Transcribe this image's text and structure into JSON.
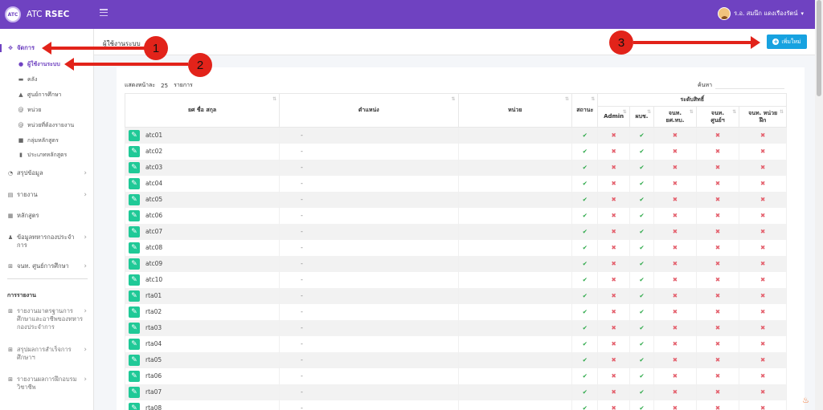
{
  "brand": {
    "prefix": "ATC",
    "name": "RSEC",
    "logo_text": "ATC"
  },
  "user": {
    "name": "ร.อ. สมนึก แดงเรืองรัตน์"
  },
  "sidebar": {
    "section_label": "การรายงาน",
    "items": [
      {
        "label": "จัดการ"
      },
      {
        "label": "ผู้ใช้งานระบบ"
      },
      {
        "label": "คลัง"
      },
      {
        "label": "ศูนย์การศึกษา"
      },
      {
        "label": "หน่วย"
      },
      {
        "label": "หน่วยที่ต้องรายงาน"
      },
      {
        "label": "กลุ่มหลักสูตร"
      },
      {
        "label": "ประเภทหลักสูตร"
      },
      {
        "label": "สรุปข้อมูล"
      },
      {
        "label": "รายงาน"
      },
      {
        "label": "หลักสูตร"
      },
      {
        "label": "ข้อมูลทหารกองประจำ",
        "label2": "การ"
      },
      {
        "label": "จนท. ศูนย์การศึกษา"
      },
      {
        "label": "รายงานมาตรฐานการ",
        "label2": "ศึกษาและอาชีพของทหาร",
        "label3": "กองประจำการ"
      },
      {
        "label": "สรุปผลการสำเร็จการ",
        "label2": "ศึกษาฯ"
      },
      {
        "label": "รายงานผลการฝึกอบรม",
        "label2": "วิชาชีพ"
      }
    ]
  },
  "page": {
    "title": "ผู้ใช้งานระบบ",
    "add_label": "เพิ่มใหม่"
  },
  "controls": {
    "show_prefix": "แสดงหน้าละ",
    "page_size": "25",
    "show_suffix": "รายการ",
    "search_label": "ค้นหา"
  },
  "table": {
    "headers": {
      "name": "ยศ ชื่อ สกุล",
      "position": "ตำแหน่ง",
      "unit": "หน่วย",
      "status": "สถานะ",
      "perm_group": "ระดับสิทธิ์",
      "admin": "Admin",
      "hq": "ผบช.",
      "off1a": "จนท.",
      "off1b": "ยศ.ทบ.",
      "off2a": "จนท.",
      "off2b": "ศูนย์ฯ",
      "off3a": "จนท. หน่วย",
      "off3b": "ฝึก"
    },
    "rows": [
      {
        "user": "atc01",
        "pos": "-",
        "status": "✔",
        "admin": "✖",
        "hq": "✔",
        "p1": "✖",
        "p2": "✖",
        "p3": "✖"
      },
      {
        "user": "atc02",
        "pos": "-",
        "status": "✔",
        "admin": "✖",
        "hq": "✔",
        "p1": "✖",
        "p2": "✖",
        "p3": "✖"
      },
      {
        "user": "atc03",
        "pos": "-",
        "status": "✔",
        "admin": "✖",
        "hq": "✔",
        "p1": "✖",
        "p2": "✖",
        "p3": "✖"
      },
      {
        "user": "atc04",
        "pos": "-",
        "status": "✔",
        "admin": "✖",
        "hq": "✔",
        "p1": "✖",
        "p2": "✖",
        "p3": "✖"
      },
      {
        "user": "atc05",
        "pos": "-",
        "status": "✔",
        "admin": "✖",
        "hq": "✔",
        "p1": "✖",
        "p2": "✖",
        "p3": "✖"
      },
      {
        "user": "atc06",
        "pos": "-",
        "status": "✔",
        "admin": "✖",
        "hq": "✔",
        "p1": "✖",
        "p2": "✖",
        "p3": "✖"
      },
      {
        "user": "atc07",
        "pos": "-",
        "status": "✔",
        "admin": "✖",
        "hq": "✔",
        "p1": "✖",
        "p2": "✖",
        "p3": "✖"
      },
      {
        "user": "atc08",
        "pos": "-",
        "status": "✔",
        "admin": "✖",
        "hq": "✔",
        "p1": "✖",
        "p2": "✖",
        "p3": "✖"
      },
      {
        "user": "atc09",
        "pos": "-",
        "status": "✔",
        "admin": "✖",
        "hq": "✔",
        "p1": "✖",
        "p2": "✖",
        "p3": "✖"
      },
      {
        "user": "atc10",
        "pos": "-",
        "status": "✔",
        "admin": "✖",
        "hq": "✔",
        "p1": "✖",
        "p2": "✖",
        "p3": "✖"
      },
      {
        "user": "rta01",
        "pos": "-",
        "status": "✔",
        "admin": "✖",
        "hq": "✔",
        "p1": "✖",
        "p2": "✖",
        "p3": "✖"
      },
      {
        "user": "rta02",
        "pos": "-",
        "status": "✔",
        "admin": "✖",
        "hq": "✔",
        "p1": "✖",
        "p2": "✖",
        "p3": "✖"
      },
      {
        "user": "rta03",
        "pos": "-",
        "status": "✔",
        "admin": "✖",
        "hq": "✔",
        "p1": "✖",
        "p2": "✖",
        "p3": "✖"
      },
      {
        "user": "rta04",
        "pos": "-",
        "status": "✔",
        "admin": "✖",
        "hq": "✔",
        "p1": "✖",
        "p2": "✖",
        "p3": "✖"
      },
      {
        "user": "rta05",
        "pos": "-",
        "status": "✔",
        "admin": "✖",
        "hq": "✔",
        "p1": "✖",
        "p2": "✖",
        "p3": "✖"
      },
      {
        "user": "rta06",
        "pos": "-",
        "status": "✔",
        "admin": "✖",
        "hq": "✔",
        "p1": "✖",
        "p2": "✖",
        "p3": "✖"
      },
      {
        "user": "rta07",
        "pos": "-",
        "status": "✔",
        "admin": "✖",
        "hq": "✔",
        "p1": "✖",
        "p2": "✖",
        "p3": "✖"
      },
      {
        "user": "rta08",
        "pos": "-",
        "status": "✔",
        "admin": "✖",
        "hq": "✔",
        "p1": "✖",
        "p2": "✖",
        "p3": "✖"
      }
    ]
  },
  "annotations": [
    "1",
    "2",
    "3"
  ],
  "colors": {
    "topbar": "#6f42c1",
    "add_button": "#17a2e0",
    "edit_button": "#20c997",
    "check": "#28a745",
    "cross": "#e4606d",
    "arrow": "#e2231a"
  }
}
